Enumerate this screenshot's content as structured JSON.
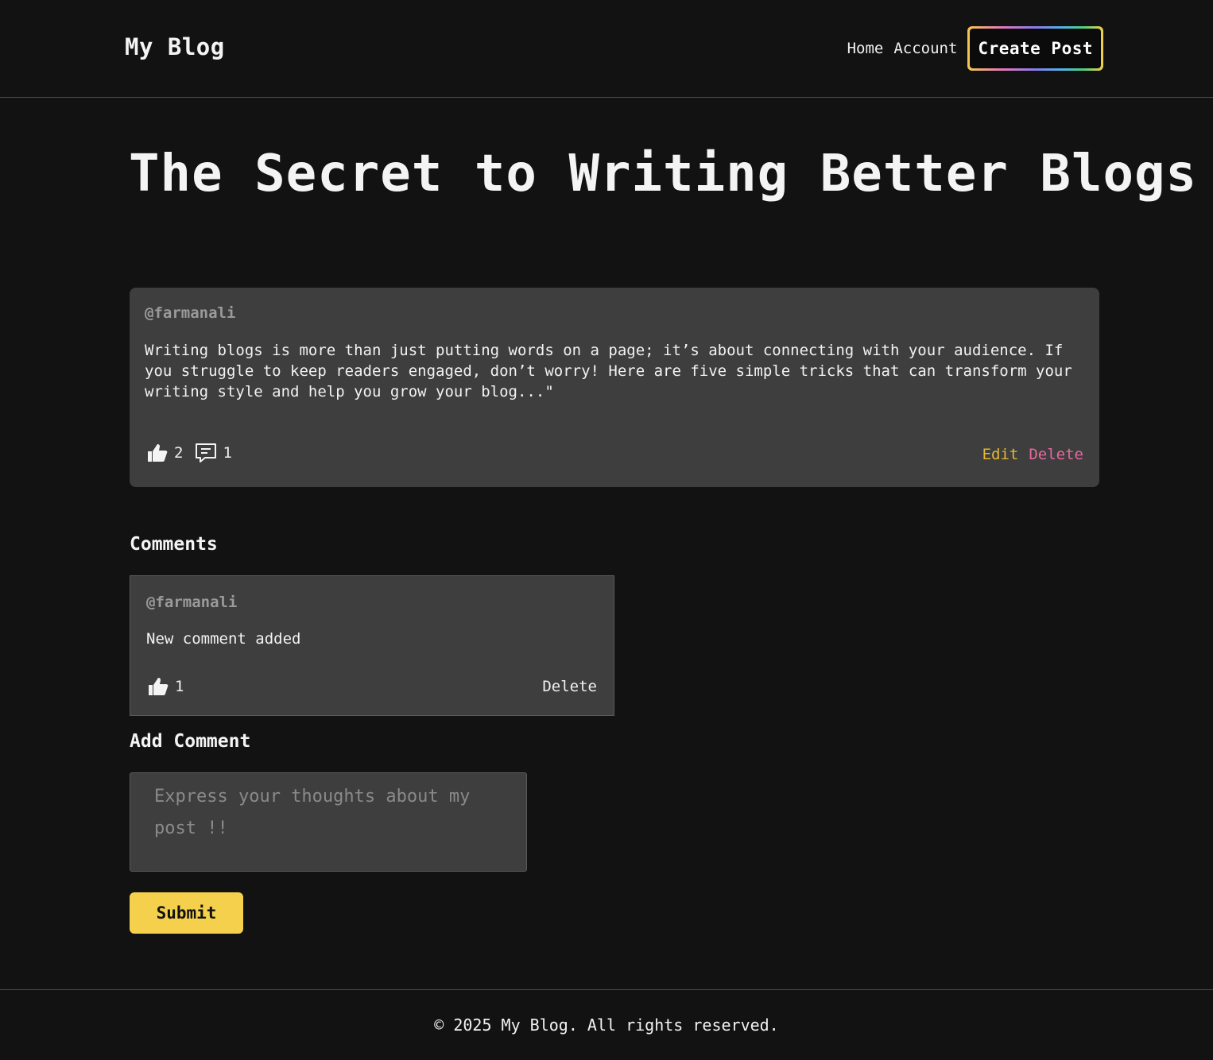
{
  "header": {
    "brand": "My Blog",
    "nav": {
      "home": "Home",
      "account": "Account",
      "create_post": "Create Post"
    }
  },
  "post": {
    "title": "The Secret to Writing Better Blogs",
    "author": "@farmanali",
    "body": "Writing blogs is more than just putting words on a page; it’s about connecting with your audience. If you struggle to keep readers engaged, don’t worry! Here are five simple tricks that can transform your writing style and help you grow your blog...\"",
    "likes": "2",
    "comments_count": "1",
    "edit_label": "Edit",
    "delete_label": "Delete",
    "icons": {
      "like": "thumbs-up-icon",
      "comment": "comment-icon"
    }
  },
  "comments_section": {
    "heading": "Comments",
    "items": [
      {
        "author": "@farmanali",
        "text": "New comment added",
        "likes": "1",
        "delete_label": "Delete"
      }
    ]
  },
  "add_comment": {
    "heading": "Add Comment",
    "placeholder": "Express your thoughts about my post !!",
    "submit_label": "Submit"
  },
  "footer": {
    "text": "© 2025 My Blog. All rights reserved."
  },
  "colors": {
    "background": "#121212",
    "card": "#3e3e3e",
    "edit": "#e7b733",
    "delete": "#e6689f",
    "submit": "#f4d04c"
  }
}
